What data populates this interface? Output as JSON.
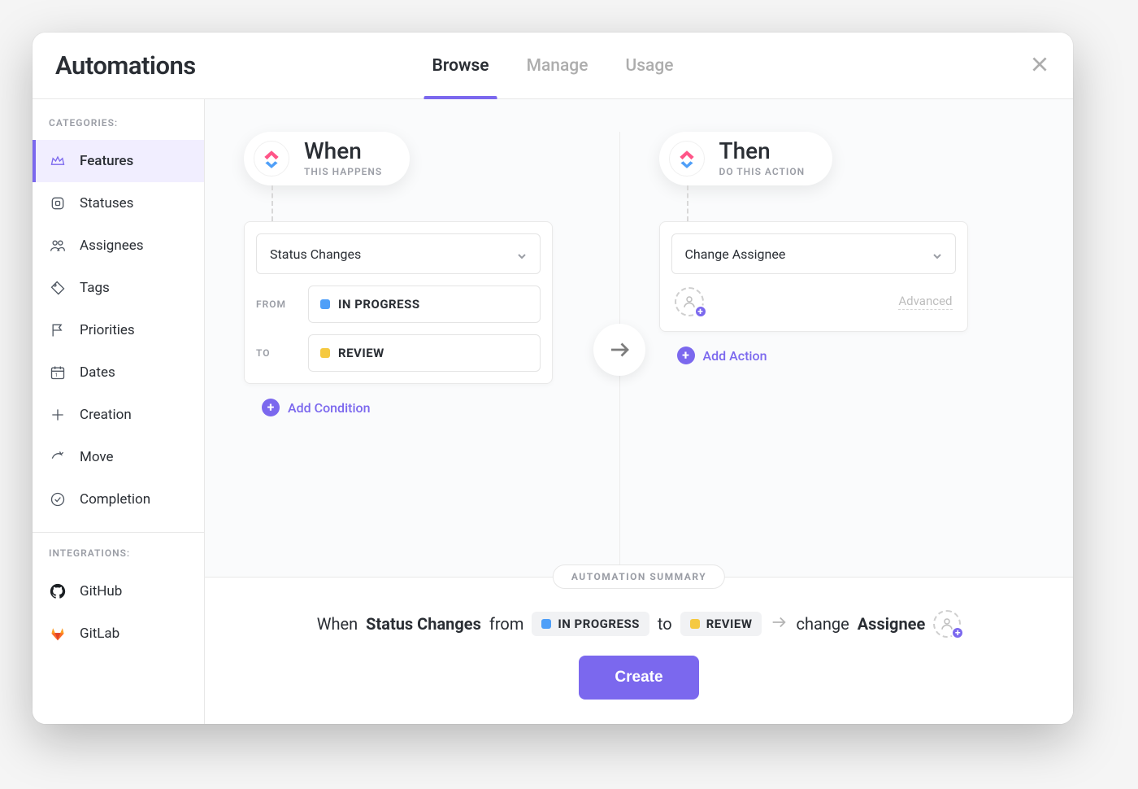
{
  "header": {
    "title": "Automations",
    "tabs": [
      {
        "label": "Browse",
        "active": true
      },
      {
        "label": "Manage",
        "active": false
      },
      {
        "label": "Usage",
        "active": false
      }
    ]
  },
  "sidebar": {
    "categories_label": "CATEGORIES:",
    "integrations_label": "INTEGRATIONS:",
    "categories": [
      {
        "id": "features",
        "label": "Features",
        "icon": "crown",
        "active": true
      },
      {
        "id": "statuses",
        "label": "Statuses",
        "icon": "status",
        "active": false
      },
      {
        "id": "assignees",
        "label": "Assignees",
        "icon": "people",
        "active": false
      },
      {
        "id": "tags",
        "label": "Tags",
        "icon": "tag",
        "active": false
      },
      {
        "id": "priorities",
        "label": "Priorities",
        "icon": "flag",
        "active": false
      },
      {
        "id": "dates",
        "label": "Dates",
        "icon": "calendar",
        "active": false
      },
      {
        "id": "creation",
        "label": "Creation",
        "icon": "plus",
        "active": false
      },
      {
        "id": "move",
        "label": "Move",
        "icon": "share",
        "active": false
      },
      {
        "id": "completion",
        "label": "Completion",
        "icon": "check",
        "active": false
      }
    ],
    "integrations": [
      {
        "id": "github",
        "label": "GitHub"
      },
      {
        "id": "gitlab",
        "label": "GitLab"
      }
    ]
  },
  "builder": {
    "when": {
      "title": "When",
      "subtitle": "THIS HAPPENS",
      "trigger": "Status Changes",
      "from_label": "FROM",
      "to_label": "TO",
      "from_status": {
        "name": "IN PROGRESS",
        "color": "#4f9ff8"
      },
      "to_status": {
        "name": "REVIEW",
        "color": "#f5c941"
      },
      "add_condition": "Add Condition"
    },
    "then": {
      "title": "Then",
      "subtitle": "DO THIS ACTION",
      "action": "Change Assignee",
      "advanced_label": "Advanced",
      "add_action": "Add Action"
    }
  },
  "summary": {
    "badge": "AUTOMATION SUMMARY",
    "when_word": "When",
    "trigger_bold": "Status Changes",
    "from_word": "from",
    "to_word": "to",
    "change_word": "change",
    "assignee_word": "Assignee",
    "from_status": {
      "name": "IN PROGRESS",
      "color": "#4f9ff8"
    },
    "to_status": {
      "name": "REVIEW",
      "color": "#f5c941"
    },
    "create_label": "Create"
  }
}
